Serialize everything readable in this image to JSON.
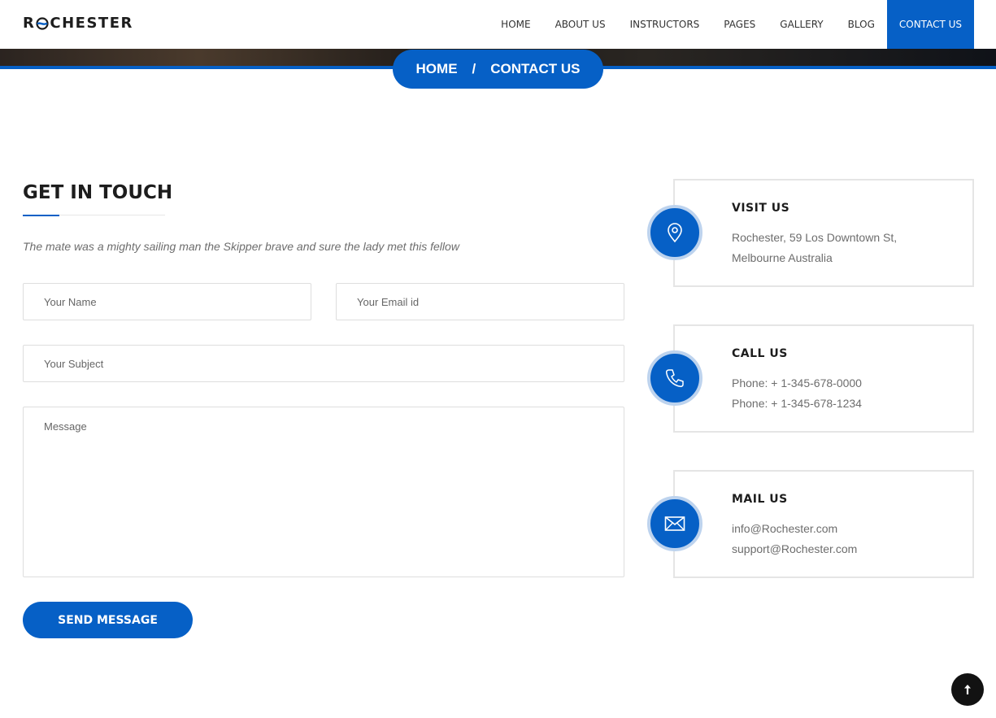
{
  "brand": {
    "left": "R",
    "right": "CHESTER"
  },
  "nav": {
    "items": [
      {
        "label": "HOME"
      },
      {
        "label": "ABOUT US"
      },
      {
        "label": "INSTRUCTORS"
      },
      {
        "label": "PAGES"
      },
      {
        "label": "GALLERY"
      },
      {
        "label": "BLOG"
      },
      {
        "label": "CONTACT US"
      }
    ],
    "active": "CONTACT US"
  },
  "breadcrumb": {
    "home": "HOME",
    "separator": "/",
    "current": "CONTACT US"
  },
  "contact_form": {
    "title": "GET IN TOUCH",
    "intro": "The mate was a mighty sailing man the Skipper brave and sure the lady met this fellow",
    "name_placeholder": "Your Name",
    "email_placeholder": "Your Email id",
    "subject_placeholder": "Your Subject",
    "message_placeholder": "Message",
    "submit_label": "SEND MESSAGE"
  },
  "info_cards": [
    {
      "icon": "map-pin-icon",
      "title": "VISIT US",
      "line1": "Rochester, 59 Los Downtown St,",
      "line2": "Melbourne Australia"
    },
    {
      "icon": "phone-icon",
      "title": "CALL US",
      "line1": "Phone: + 1-345-678-0000",
      "line2": "Phone: + 1-345-678-1234"
    },
    {
      "icon": "envelope-icon",
      "title": "MAIL US",
      "line1": "info@Rochester.com",
      "line2": "support@Rochester.com"
    }
  ],
  "colors": {
    "accent": "#0660c6",
    "accent_ring": "#bdd3ee",
    "text_muted": "#6d6d6d",
    "scroll_button": "#121212"
  },
  "scroll_top": {
    "icon": "arrow-up-icon"
  }
}
